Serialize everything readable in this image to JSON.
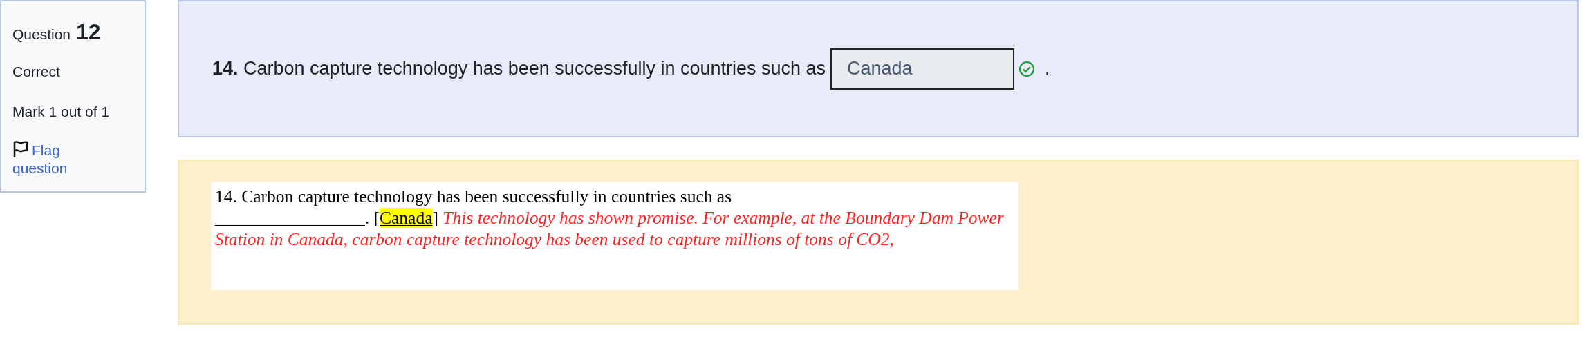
{
  "info": {
    "label": "Question",
    "number": "12",
    "state": "Correct",
    "mark": "Mark 1 out of 1",
    "flag": {
      "label": "Flag question",
      "flagged": false
    }
  },
  "question": {
    "number": "14.",
    "text": "Carbon capture technology has been successfully in countries such as",
    "answer": "Canada",
    "correct": true,
    "after": "."
  },
  "feedback": {
    "segments": [
      {
        "kind": "plain",
        "text": "14. Carbon capture technology has been successfully in countries such as"
      },
      {
        "kind": "break"
      },
      {
        "kind": "plain",
        "text": "_________________. ["
      },
      {
        "kind": "highlight",
        "text": "Canada"
      },
      {
        "kind": "plain",
        "text": "]"
      },
      {
        "kind": "note",
        "text": " This technology has shown promise. For example, at the Boundary Dam Power Station in Canada, carbon capture technology has been used to capture millions of tons of CO2,"
      }
    ]
  }
}
